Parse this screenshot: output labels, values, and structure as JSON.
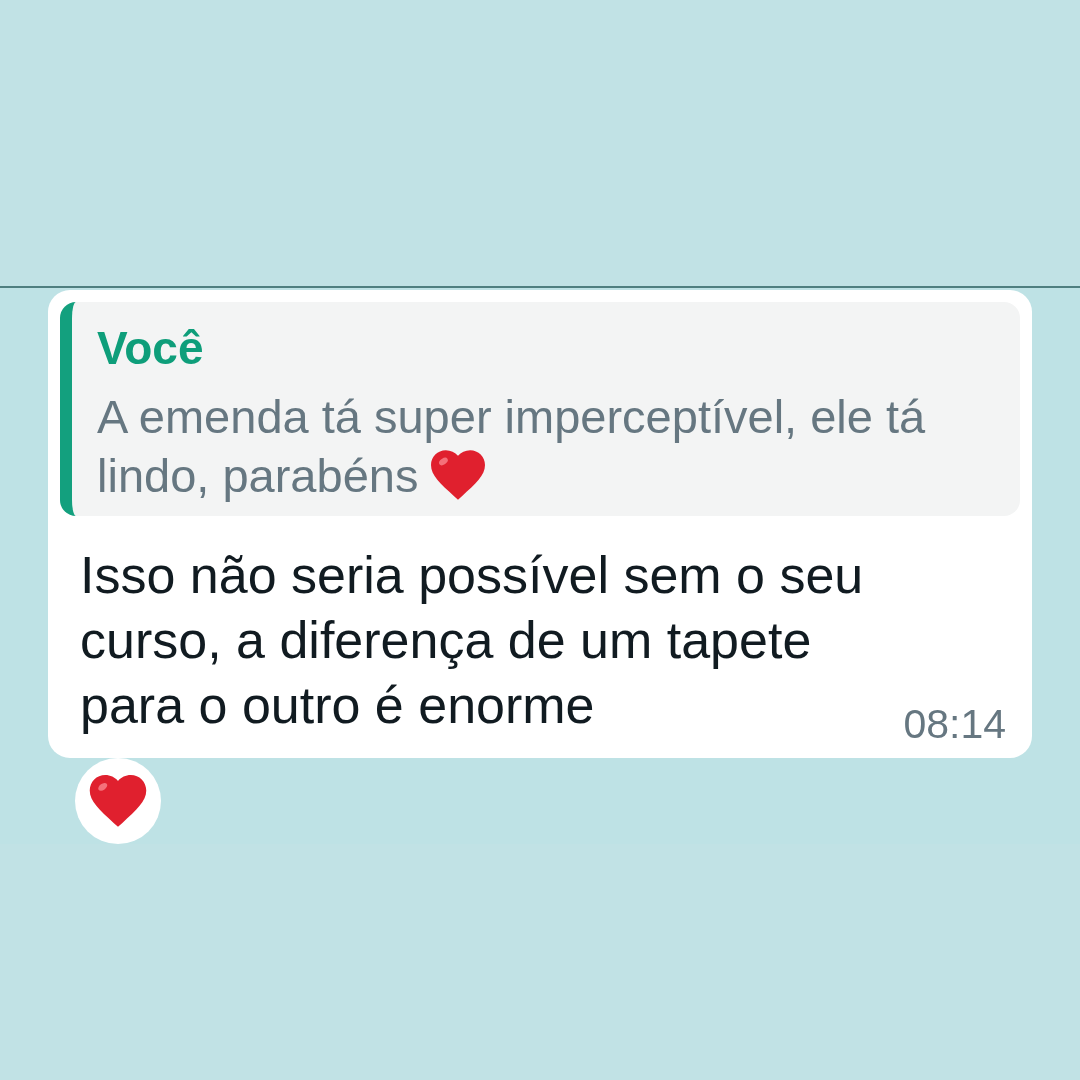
{
  "chat": {
    "message": {
      "quote": {
        "author": "Você",
        "text": "A emenda tá super imperceptível, ele tá lindo, parabéns"
      },
      "text": "Isso não seria possível sem o seu curso, a diferença de um tapete para o outro é enorme",
      "time": "08:14"
    }
  }
}
